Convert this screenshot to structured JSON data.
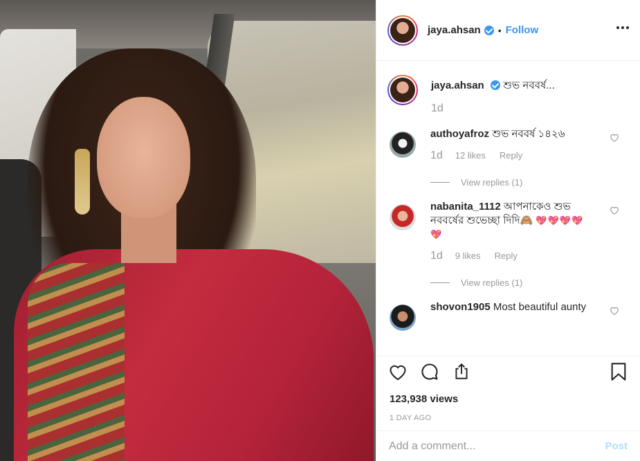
{
  "post": {
    "username": "jaya.ahsan",
    "follow_label": "Follow",
    "dot": "•",
    "caption_text": "শুভ নববর্ষ...",
    "caption_age": "1d"
  },
  "comments": [
    {
      "username": "authoyafroz",
      "text": "শুভ নববর্ষ ১৪২৬",
      "emoji": "",
      "age": "1d",
      "likes": "12 likes",
      "reply_label": "Reply",
      "view_replies": "View replies (1)"
    },
    {
      "username": "nabanita_1112",
      "text": "আপনাকেও শুভ নববর্ষের শুভেচ্ছা দিদি🙈",
      "emoji": "💖💖💖💖💖",
      "age": "1d",
      "likes": "9 likes",
      "reply_label": "Reply",
      "view_replies": "View replies (1)"
    },
    {
      "username": "shovon1905",
      "text": "Most beautiful aunty",
      "emoji": "",
      "age": "",
      "likes": "",
      "reply_label": "",
      "view_replies": ""
    }
  ],
  "stats": {
    "views": "123,938 views",
    "date": "1 DAY AGO"
  },
  "add_comment": {
    "placeholder": "Add a comment...",
    "post_label": "Post"
  },
  "colors": {
    "accent": "#3897f0",
    "muted": "#999999",
    "post_disabled": "#b2dffc"
  },
  "icons": [
    "more-icon",
    "heart-icon",
    "comment-icon",
    "share-icon",
    "bookmark-icon",
    "verified-icon"
  ]
}
